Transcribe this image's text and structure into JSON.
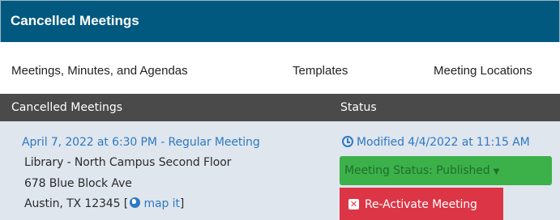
{
  "header": {
    "title": "Cancelled Meetings"
  },
  "tabs": [
    {
      "label": "Meetings, Minutes, and Agendas"
    },
    {
      "label": "Templates"
    },
    {
      "label": "Meeting Locations"
    }
  ],
  "table": {
    "columns": [
      "Cancelled Meetings",
      "Status"
    ],
    "rows": [
      {
        "meeting": "April 7, 2022 at 6:30 PM - Regular Meeting",
        "location": "Library - North Campus Second Floor",
        "street": "678 Blue Block Ave",
        "city": "Austin, TX 12345 [",
        "map_link": "map it",
        "map_close": "]",
        "modified": "Modified 4/4/2022 at 11:15 AM",
        "status_button": "Meeting Status: Published",
        "reactivate_button": "Re-Activate Meeting"
      }
    ]
  },
  "colors": {
    "header_bg": "#02597f",
    "table_head_bg": "#4a4a4a",
    "row_bg": "#dfe6ee",
    "link": "#2f79c2",
    "status_green": "#3cb14a",
    "danger_red": "#dc3545"
  },
  "icons": [
    "clock-icon",
    "globe-icon",
    "caret-down-icon",
    "close-icon"
  ]
}
